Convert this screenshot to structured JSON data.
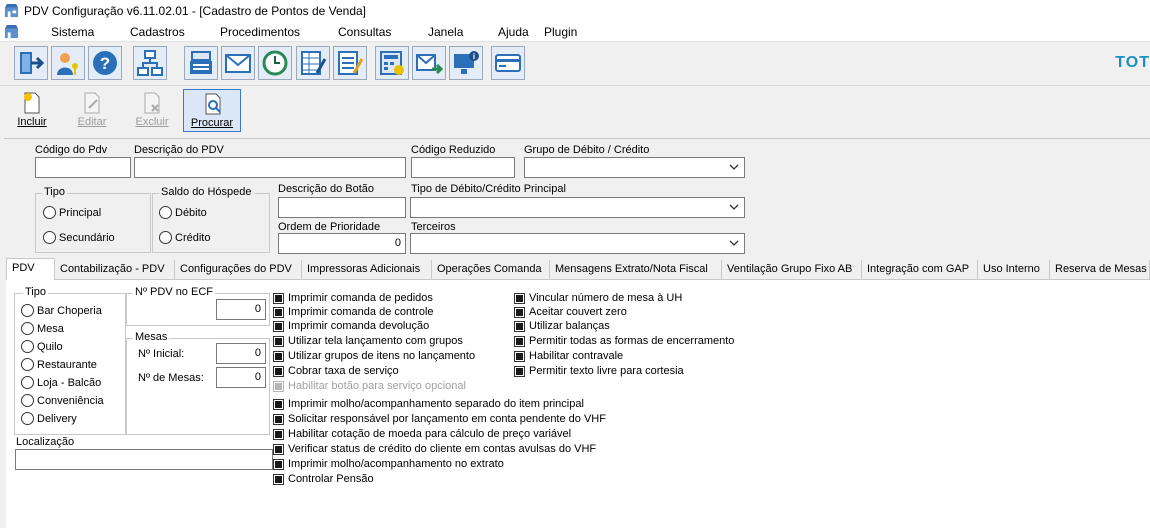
{
  "window": {
    "title": "PDV Configuração v6.11.02.01 - [Cadastro de Pontos de Venda]"
  },
  "menu": [
    "Sistema",
    "Cadastros",
    "Procedimentos",
    "Consultas",
    "Janela",
    "Ajuda",
    "Plugin"
  ],
  "toolbar": {
    "icons": [
      "logout-icon",
      "user-key-icon",
      "help-icon",
      "organization-icon",
      "cash-register-icon",
      "mail-icon",
      "history-clock-icon",
      "edit-grid-icon",
      "edit-list-icon",
      "calculator-icon",
      "send-mail-icon",
      "monitor-info-icon",
      "credit-card-icon"
    ],
    "brand": "TOT"
  },
  "actions": [
    {
      "label": "Incluir",
      "state": "enabled"
    },
    {
      "label": "Editar",
      "state": "disabled"
    },
    {
      "label": "Excluir",
      "state": "disabled"
    },
    {
      "label": "Procurar",
      "state": "selected"
    }
  ],
  "form": {
    "codigo_label": "Código do Pdv",
    "codigo_value": "",
    "descricao_label": "Descrição do PDV",
    "descricao_value": "",
    "codigo_reduzido_label": "Código Reduzido",
    "codigo_reduzido_value": "",
    "grupo_label": "Grupo de Débito / Crédito",
    "grupo_value": "",
    "tipo_label": "Tipo",
    "tipo_options": [
      "Principal",
      "Secundário"
    ],
    "saldo_label": "Saldo do Hóspede",
    "saldo_options": [
      "Débito",
      "Crédito"
    ],
    "desc_botao_label": "Descrição do Botão",
    "desc_botao_value": "",
    "tipo_debito_label": "Tipo de Débito/Crédito Principal",
    "tipo_debito_value": "",
    "ordem_label": "Ordem de Prioridade",
    "ordem_value": "0",
    "terceiros_label": "Terceiros",
    "terceiros_value": ""
  },
  "tabs": [
    "PDV",
    "Contabilização - PDV",
    "Configurações do PDV",
    "Impressoras Adicionais",
    "Operações Comanda",
    "Mensagens Extrato/Nota Fiscal",
    "Ventilação Grupo Fixo AB",
    "Integração com GAP",
    "Uso Interno",
    "Reserva de Mesas"
  ],
  "active_tab": "PDV",
  "pdv": {
    "tipo_label": "Tipo",
    "tipo_options": [
      "Bar Choperia",
      "Mesa",
      "Quilo",
      "Restaurante",
      "Loja - Balcão",
      "Conveniência",
      "Delivery"
    ],
    "ecf_label": "Nº PDV no ECF",
    "ecf_value": "0",
    "mesas_label": "Mesas",
    "inicial_label": "Nº Inicial:",
    "inicial_value": "0",
    "num_mesas_label": "Nº de Mesas:",
    "num_mesas_value": "0",
    "localizacao_label": "Localização",
    "localizacao_value": "",
    "checks_col1": [
      {
        "label": "Imprimir comanda de pedidos",
        "checked": true
      },
      {
        "label": "Imprimir comanda de controle",
        "checked": true
      },
      {
        "label": "Imprimir comanda devolução",
        "checked": true
      },
      {
        "label": "Utilizar tela lançamento com grupos",
        "checked": true
      },
      {
        "label": "Utilizar grupos de itens no lançamento",
        "checked": true
      },
      {
        "label": "Cobrar taxa de serviço",
        "checked": true
      },
      {
        "label": "Habilitar botão para serviço opcional",
        "checked": true,
        "disabled": true
      }
    ],
    "checks_col2": [
      {
        "label": "Vincular número de mesa à UH",
        "checked": true
      },
      {
        "label": "Aceitar couvert zero",
        "checked": true
      },
      {
        "label": "Utilizar balanças",
        "checked": true
      },
      {
        "label": "Permitir todas as formas de encerramento",
        "checked": true
      },
      {
        "label": "Habilitar contravale",
        "checked": true
      },
      {
        "label": "Permitir texto livre para cortesia",
        "checked": true
      }
    ],
    "checks_col3": [
      {
        "label": "Imprimir molho/acompanhamento separado do item principal",
        "checked": true
      },
      {
        "label": "Solicitar responsável por lançamento em conta pendente do VHF",
        "checked": true
      },
      {
        "label": "Habilitar cotação de moeda para cálculo de preço variável",
        "checked": true
      },
      {
        "label": "Verificar status de crédito do cliente em contas avulsas do VHF",
        "checked": true
      },
      {
        "label": "Imprimir molho/acompanhamento no extrato",
        "checked": true
      },
      {
        "label": "Controlar Pensão",
        "checked": true
      }
    ]
  }
}
